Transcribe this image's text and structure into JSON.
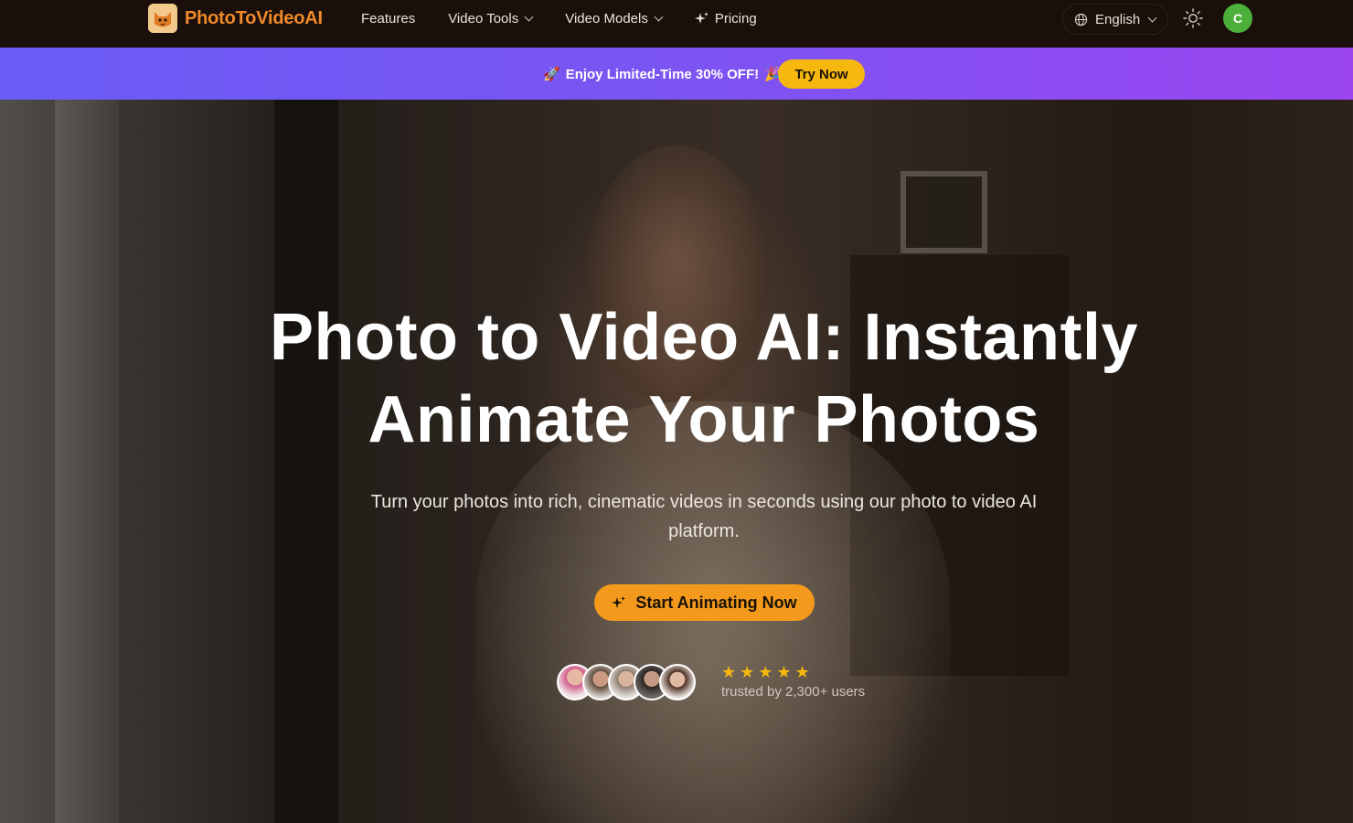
{
  "nav": {
    "brand": "PhotoToVideoAI",
    "links": [
      {
        "label": "Features",
        "has_dropdown": false
      },
      {
        "label": "Video Tools",
        "has_dropdown": true
      },
      {
        "label": "Video Models",
        "has_dropdown": true
      },
      {
        "label": "Pricing",
        "has_dropdown": false,
        "icon": "sparkle-icon"
      }
    ],
    "language": "English",
    "theme_icon": "sun-icon",
    "avatar_initial": "C",
    "avatar_color": "#4caf3a"
  },
  "promo": {
    "text": "Enjoy Limited-Time 30% OFF!",
    "leading_emoji": "🚀",
    "trailing_emoji": "🎉",
    "button": "Try Now",
    "accent": "#f6b80e"
  },
  "hero": {
    "title_line1": "Photo to Video AI: Instantly",
    "title_line2": "Animate Your Photos",
    "subtitle": "Turn your photos into rich, cinematic videos in seconds using our photo to video AI platform.",
    "cta": "Start Animating Now",
    "cta_color": "#f39a1c",
    "rating_stars": 5,
    "trusted_text": "trusted by 2,300+ users"
  }
}
